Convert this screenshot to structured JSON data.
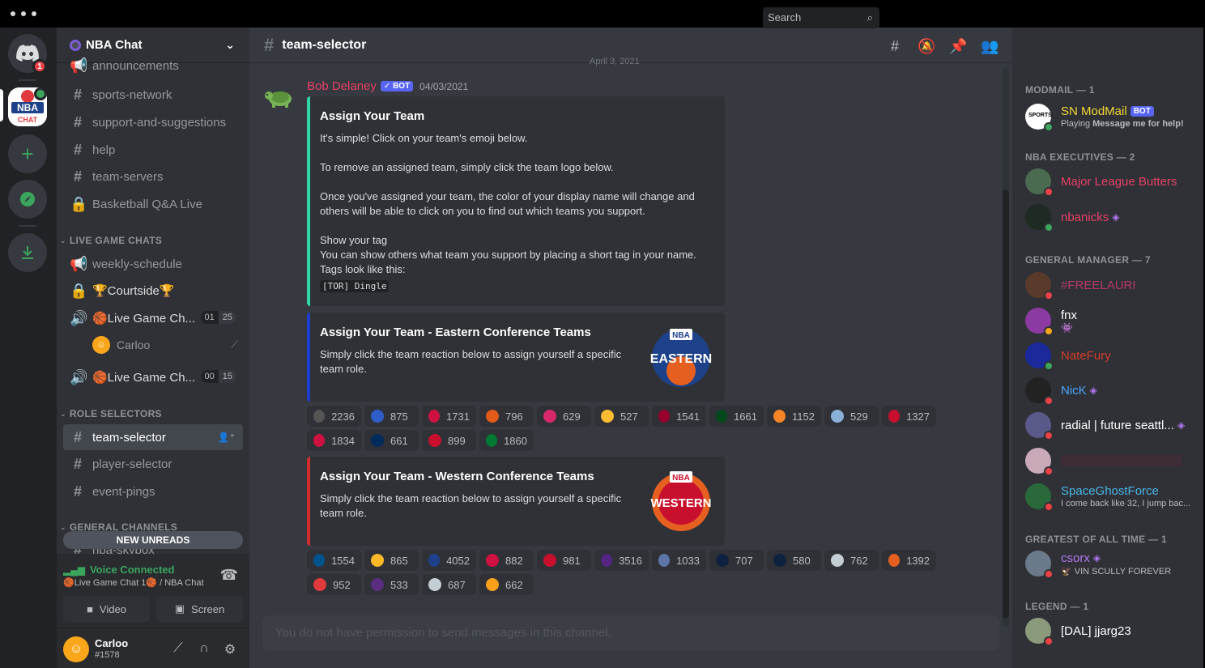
{
  "colors": {
    "blurple": "#5865f2",
    "green": "#3ba55d",
    "red": "#ed4245",
    "eastern_bar": "#1e3ed1",
    "western_bar": "#d12b2b",
    "assign_bar": "#2fd6a8"
  },
  "server_rail": {
    "home_badge": "1"
  },
  "guild": {
    "name": "NBA Chat"
  },
  "channels": [
    {
      "name": "announcements",
      "icon": "megaphone-icon"
    },
    {
      "name": "sports-network",
      "icon": "hash-icon"
    },
    {
      "name": "support-and-suggestions",
      "icon": "hash-icon"
    },
    {
      "name": "help",
      "icon": "hash-icon"
    },
    {
      "name": "team-servers",
      "icon": "hash-icon"
    },
    {
      "name": "Basketball Q&A Live",
      "icon": "lock-icon"
    }
  ],
  "live_game": {
    "category": "LIVE GAME CHATS",
    "weekly": "weekly-schedule",
    "courtside": "🏆Courtside🏆",
    "voice1": "🏀Live Game Ch...",
    "voice1_count": [
      "01",
      "25"
    ],
    "voice1_user": "Carloo",
    "voice2": "🏀Live Game Ch...",
    "voice2_count": [
      "00",
      "15"
    ]
  },
  "roles": {
    "category": "ROLE SELECTORS",
    "items": [
      "team-selector",
      "player-selector",
      "event-pings"
    ]
  },
  "general": {
    "category": "GENERAL CHANNELS",
    "partial": "nba-skybox",
    "new_unreads": "NEW UNREADS"
  },
  "voice_panel": {
    "status": "Voice Connected",
    "sub": "🏀Live Game Chat 1🏀 / NBA Chat",
    "video": "Video",
    "screen": "Screen"
  },
  "user": {
    "name": "Carloo",
    "tag": "#1578"
  },
  "chat": {
    "channel": "team-selector",
    "search_placeholder": "Search",
    "date_divider": "April 3, 2021",
    "author": "Bob Delaney",
    "bot": "✓ BOT",
    "timestamp": "04/03/2021",
    "composer": "You do not have permission to send messages in this channel."
  },
  "embeds": {
    "assign": {
      "title": "Assign Your Team",
      "p1": "It's simple! Click on your team's emoji below.",
      "p2": "To remove an assigned team, simply click the team logo below.",
      "p3": "Once you've assigned your team, the color of your display name will change and others will be able to click on you to find out which teams you support.",
      "p4": "Show your tag\nYou can show others what team you support by placing a short tag in your name.\nTags look like this:",
      "code": "[TOR] Dingle"
    },
    "eastern": {
      "title": "Assign Your Team - Eastern Conference Teams",
      "desc": "Simply click the team reaction below to assign yourself a specific team role.",
      "logo_top": "NBA",
      "logo_text": "EASTERN"
    },
    "western": {
      "title": "Assign Your Team - Western Conference Teams",
      "desc": "Simply click the team reaction below to assign yourself a specific team role.",
      "logo_top": "NBA",
      "logo_text": "WESTERN"
    }
  },
  "eastern_reactions": [
    {
      "count": "2236",
      "color": "#555"
    },
    {
      "count": "875",
      "color": "#2f5ec9"
    },
    {
      "count": "1731",
      "color": "#ce1141"
    },
    {
      "count": "796",
      "color": "#e05a1a"
    },
    {
      "count": "629",
      "color": "#d6286a"
    },
    {
      "count": "527",
      "color": "#fdbb30"
    },
    {
      "count": "1541",
      "color": "#98002e"
    },
    {
      "count": "1661",
      "color": "#00471b"
    },
    {
      "count": "1152",
      "color": "#f58426"
    },
    {
      "count": "529",
      "color": "#8ab0d8"
    },
    {
      "count": "1327",
      "color": "#c8102e"
    },
    {
      "count": "1834",
      "color": "#ce1141"
    },
    {
      "count": "661",
      "color": "#002b5c"
    },
    {
      "count": "899",
      "color": "#c8102e"
    },
    {
      "count": "1860",
      "color": "#007a33"
    }
  ],
  "western_reactions": [
    {
      "count": "1554",
      "color": "#00538c"
    },
    {
      "count": "865",
      "color": "#fdb927"
    },
    {
      "count": "4052",
      "color": "#1d428a"
    },
    {
      "count": "882",
      "color": "#ce1141"
    },
    {
      "count": "981",
      "color": "#c8102e"
    },
    {
      "count": "3516",
      "color": "#552583"
    },
    {
      "count": "1033",
      "color": "#5d76a9"
    },
    {
      "count": "707",
      "color": "#0e2240"
    },
    {
      "count": "580",
      "color": "#0c2340"
    },
    {
      "count": "762",
      "color": "#c4ced4"
    },
    {
      "count": "1392",
      "color": "#e56020"
    },
    {
      "count": "952",
      "color": "#e03a3e"
    },
    {
      "count": "533",
      "color": "#5a2d81"
    },
    {
      "count": "687",
      "color": "#c4ced4"
    },
    {
      "count": "662",
      "color": "#f9a01b"
    }
  ],
  "members": {
    "groups": [
      {
        "label": "MODMAIL — 1"
      },
      {
        "label": "NBA EXECUTIVES — 2"
      },
      {
        "label": "GENERAL MANAGER — 7"
      },
      {
        "label": "GREATEST OF ALL TIME — 1"
      },
      {
        "label": "LEGEND — 1"
      }
    ],
    "modmail": {
      "name": "SN ModMail",
      "bot": "BOT",
      "sub_prefix": "Playing ",
      "sub_bold": "Message me for help!"
    },
    "execs": [
      {
        "name": "Major League Butters",
        "color": "#e84065"
      },
      {
        "name": "nbanicks",
        "color": "#e84065"
      }
    ],
    "gms": [
      {
        "name": "#FREELAURI",
        "color": "#b8386a",
        "sub": ""
      },
      {
        "name": "fnx",
        "color": "#ffffff",
        "sub": ""
      },
      {
        "name": "NateFury",
        "color": "#d63d2b",
        "sub": ""
      },
      {
        "name": "NicK",
        "color": "#4aa3ff",
        "sub": ""
      },
      {
        "name": "radial | future seattl...",
        "color": "#ffffff",
        "sub": ""
      },
      {
        "name": "",
        "color": "#a02a55",
        "sub": ""
      },
      {
        "name": "SpaceGhostForce",
        "color": "#4ab5e8",
        "sub": "I come back like 32, I jump bac..."
      }
    ],
    "goat": {
      "name": "csorx",
      "sub": "🦅 VIN SCULLY FOREVER"
    },
    "legend": {
      "name": "[DAL] jjarg23"
    }
  }
}
